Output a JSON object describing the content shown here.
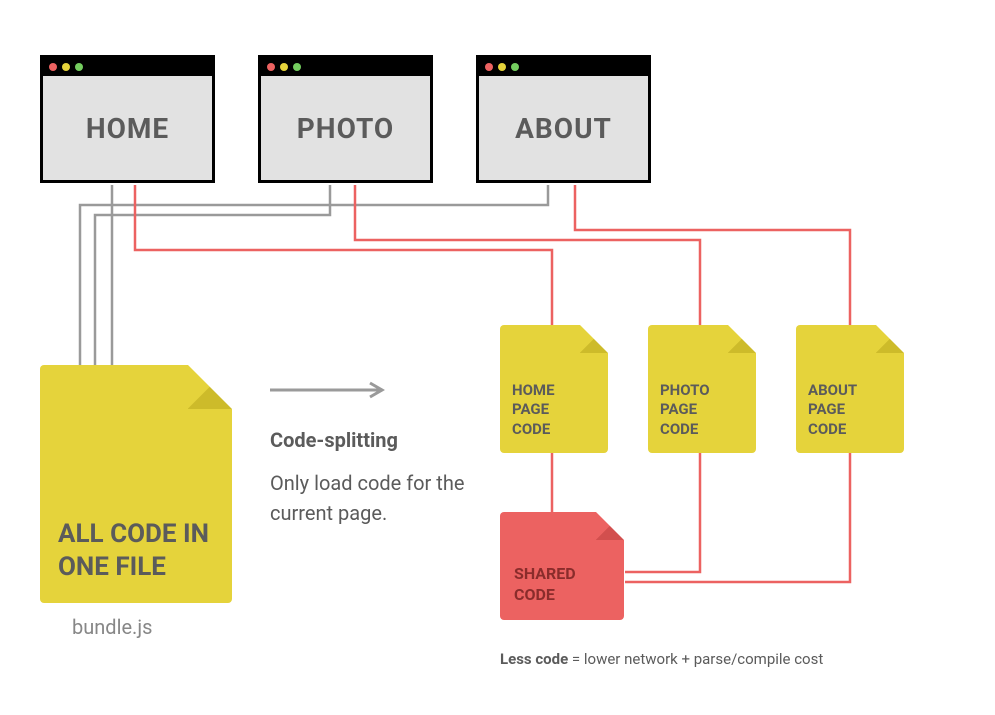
{
  "windows": {
    "home": "HOME",
    "photo": "PHOTO",
    "about": "ABOUT"
  },
  "files": {
    "bundle_label": "ALL CODE IN ONE FILE",
    "bundle_caption": "bundle.js",
    "home_label": "HOME\nPAGE\nCODE",
    "photo_label": "PHOTO\nPAGE\nCODE",
    "about_label": "ABOUT\nPAGE\nCODE",
    "shared_label": "SHARED\nCODE"
  },
  "text": {
    "title": "Code-splitting",
    "body": "Only load code for the current page."
  },
  "footnote": {
    "bold": "Less code",
    "rest": " = lower network + parse/compile cost"
  }
}
